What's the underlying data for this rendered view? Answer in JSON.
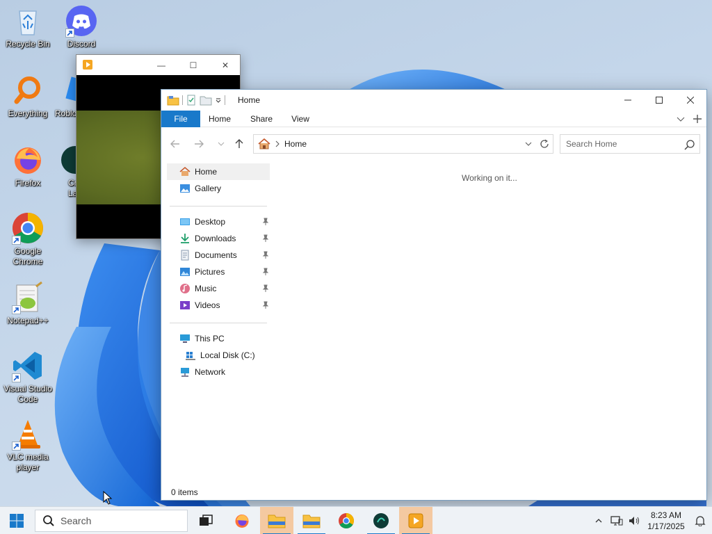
{
  "colors": {
    "accent": "#1979ca",
    "taskbar_bg": "#eef2f6",
    "active_app_bg": "#f4c9a1",
    "desktop_bloom": "#1468d9"
  },
  "desktop": {
    "icons": [
      {
        "label": "Recycle Bin",
        "icon": "recycle-bin-icon"
      },
      {
        "label": "Discord",
        "icon": "discord-icon"
      },
      {
        "label": "Everything",
        "icon": "everything-search-icon"
      },
      {
        "label": "Roblo",
        "icon": "roblox-icon"
      },
      {
        "label": "Firefox",
        "icon": "firefox-icon"
      },
      {
        "label": "Cr\nLau",
        "icon": "launcher-icon"
      },
      {
        "label": "Google Chrome",
        "icon": "chrome-icon"
      },
      {
        "label": "Notepad++",
        "icon": "notepadpp-icon"
      },
      {
        "label": "Visual Studio Code",
        "icon": "vscode-icon"
      },
      {
        "label": "VLC media player",
        "icon": "vlc-icon"
      }
    ]
  },
  "video_window": {
    "controls": {
      "minimize": "—",
      "maximize": "☐",
      "close": "✕"
    }
  },
  "explorer": {
    "title": "Home",
    "ribbon": {
      "tabs": [
        {
          "label": "File"
        },
        {
          "label": "Home"
        },
        {
          "label": "Share"
        },
        {
          "label": "View"
        }
      ]
    },
    "address": {
      "crumb": "Home"
    },
    "search": {
      "placeholder": "Search Home"
    },
    "nav": {
      "quick": [
        {
          "label": "Home"
        },
        {
          "label": "Gallery"
        }
      ],
      "pinned": [
        {
          "label": "Desktop"
        },
        {
          "label": "Downloads"
        },
        {
          "label": "Documents"
        },
        {
          "label": "Pictures"
        },
        {
          "label": "Music"
        },
        {
          "label": "Videos"
        }
      ],
      "devices": [
        {
          "label": "This PC"
        },
        {
          "label": "Local Disk (C:)"
        },
        {
          "label": "Network"
        }
      ]
    },
    "content_message": "Working on it...",
    "status": "0 items"
  },
  "taskbar": {
    "search_placeholder": "Search",
    "apps": [
      {
        "name": "task-view"
      },
      {
        "name": "firefox"
      },
      {
        "name": "file-explorer",
        "active": true
      },
      {
        "name": "file-explorer-2"
      },
      {
        "name": "chrome"
      },
      {
        "name": "launcher"
      },
      {
        "name": "vlc-video",
        "active": true
      }
    ],
    "clock": {
      "time": "8:23 AM",
      "date": "1/17/2025"
    }
  }
}
